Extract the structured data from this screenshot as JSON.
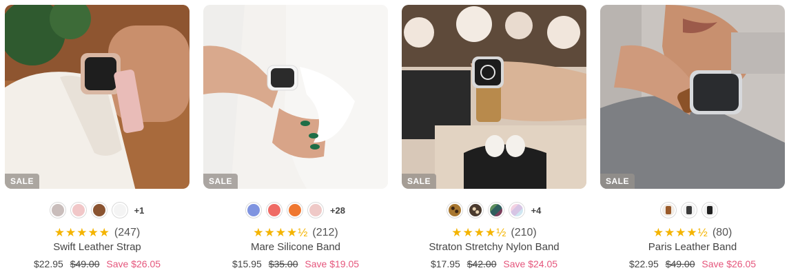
{
  "products": [
    {
      "badge": "SALE",
      "swatches": [
        "#c9bdbb",
        "#f1c7c8",
        "#8a5431",
        "#f4f4f4"
      ],
      "swatch_names": [
        "taupe",
        "blush pink",
        "brown",
        "white"
      ],
      "more": "+1",
      "stars": "★★★★★",
      "rating_count": "(247)",
      "title": "Swift Leather Strap",
      "price": "$22.95",
      "compare_price": "$49.00",
      "savings": "Save $26.05"
    },
    {
      "badge": "SALE",
      "swatches": [
        "#7f94e0",
        "#ef6b65",
        "#ef7730",
        "#efc9c7"
      ],
      "swatch_names": [
        "periwinkle",
        "coral",
        "orange",
        "light pink"
      ],
      "more": "+28",
      "stars": "★★★★½",
      "rating_count": "(212)",
      "title": "Mare Silicone Band",
      "price": "$15.95",
      "compare_price": "$35.00",
      "savings": "Save $19.05"
    },
    {
      "badge": "SALE",
      "swatches": [
        "#a8772f",
        "#4a3a2e",
        "#2f5e5d",
        "#d6c4e4"
      ],
      "swatch_names": [
        "leopard",
        "black leopard",
        "teal stripe",
        "pastel stripe"
      ],
      "more": "+4",
      "stars": "★★★★½",
      "rating_count": "(210)",
      "title": "Straton Stretchy Nylon Band",
      "price": "$17.95",
      "compare_price": "$42.00",
      "savings": "Save $24.05"
    },
    {
      "badge": "SALE",
      "swatches": [
        "#9a5a2a",
        "#3b3b3b",
        "#1f1f1f"
      ],
      "swatch_names": [
        "brown watch",
        "graphite watch",
        "black watch"
      ],
      "more": "",
      "stars": "★★★★½",
      "rating_count": "(80)",
      "title": "Paris Leather Band",
      "price": "$22.95",
      "compare_price": "$49.00",
      "savings": "Save $26.05"
    }
  ],
  "colors": {
    "accent_sale_text": "#e5567c",
    "star": "#f4b400"
  }
}
